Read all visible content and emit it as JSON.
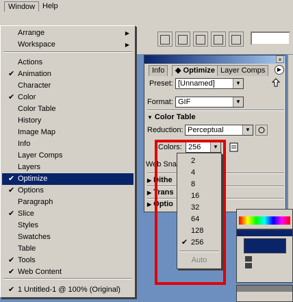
{
  "menubar": {
    "items": [
      "Window",
      "Help"
    ]
  },
  "window_menu": {
    "items": [
      {
        "label": "Arrange",
        "checked": false,
        "submenu": true
      },
      {
        "label": "Workspace",
        "checked": false,
        "submenu": true
      },
      {
        "label": "Actions",
        "checked": false
      },
      {
        "label": "Animation",
        "checked": true
      },
      {
        "label": "Character",
        "checked": false
      },
      {
        "label": "Color",
        "checked": true
      },
      {
        "label": "Color Table",
        "checked": false
      },
      {
        "label": "History",
        "checked": false
      },
      {
        "label": "Image Map",
        "checked": false
      },
      {
        "label": "Info",
        "checked": false
      },
      {
        "label": "Layer Comps",
        "checked": false
      },
      {
        "label": "Layers",
        "checked": false
      },
      {
        "label": "Optimize",
        "checked": true,
        "selected": true
      },
      {
        "label": "Options",
        "checked": true
      },
      {
        "label": "Paragraph",
        "checked": false
      },
      {
        "label": "Slice",
        "checked": true
      },
      {
        "label": "Styles",
        "checked": false
      },
      {
        "label": "Swatches",
        "checked": false
      },
      {
        "label": "Table",
        "checked": false
      },
      {
        "label": "Tools",
        "checked": true
      },
      {
        "label": "Web Content",
        "checked": true
      },
      {
        "label": "1 Untitled-1 @ 100% (Original)",
        "checked": true
      }
    ],
    "check_glyph": "✔",
    "submenu_glyph": "▶"
  },
  "panel": {
    "close_glyph": "×",
    "tabs": [
      "Info",
      "Optimize",
      "Layer Comps"
    ],
    "tab_arrow": "▶",
    "active_tab_prefix": "◆",
    "preset_label": "Preset:",
    "preset_value": "[Unnamed]",
    "format_label": "Format:",
    "format_value": "GIF",
    "color_table_label": "Color Table",
    "reduction_label": "Reduction:",
    "reduction_value": "Perceptual",
    "colors_label": "Colors:",
    "colors_value": "256",
    "web_snap_label": "Web Snap",
    "dither_label": "Dithe",
    "transparency_label": "Trans",
    "options_label": "Optio"
  },
  "colors_list": {
    "items": [
      {
        "value": "2",
        "checked": false
      },
      {
        "value": "4",
        "checked": false
      },
      {
        "value": "8",
        "checked": false
      },
      {
        "value": "16",
        "checked": false
      },
      {
        "value": "32",
        "checked": false
      },
      {
        "value": "64",
        "checked": false
      },
      {
        "value": "128",
        "checked": false
      },
      {
        "value": "256",
        "checked": true
      }
    ],
    "auto_label": "Auto"
  },
  "highlight_color": "#e00000"
}
